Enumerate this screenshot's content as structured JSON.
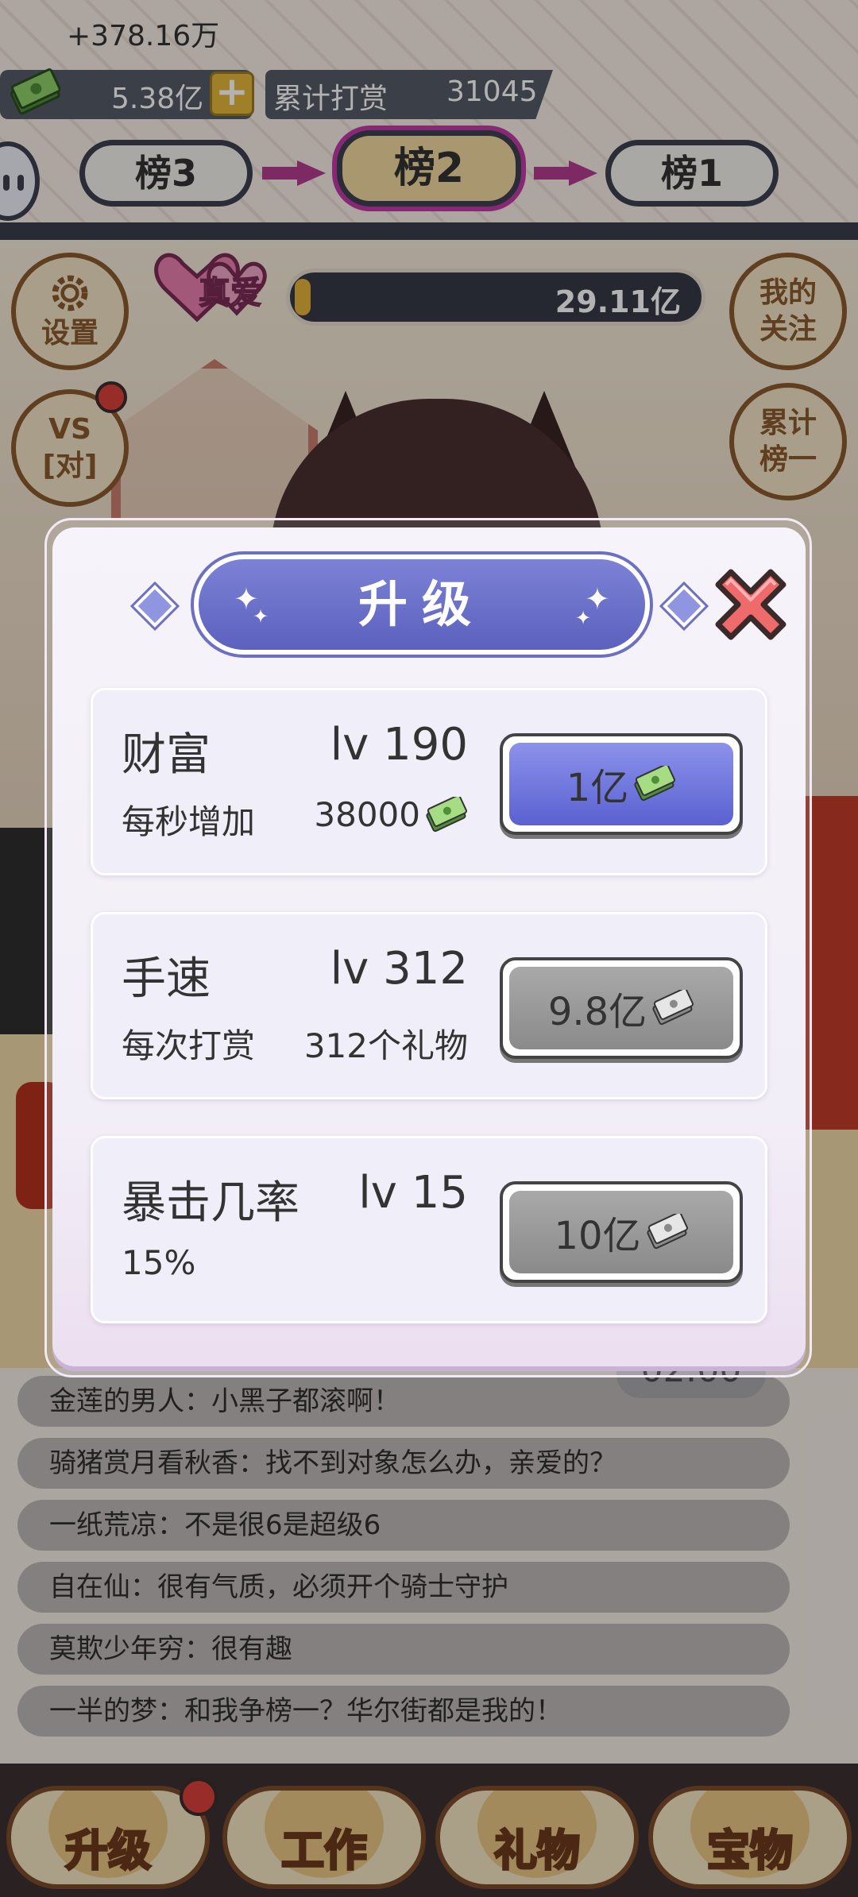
{
  "header": {
    "gain": "+378.16万",
    "money": "5.38亿",
    "plus": "+",
    "reward_label": "累计打赏",
    "reward_value": "31045"
  },
  "ranks": [
    "榜3",
    "榜2",
    "榜1"
  ],
  "side_buttons": {
    "settings": "设置",
    "vs": "VS\n[对]",
    "follow": "我的\n关注",
    "cumulative": "累计\n榜一"
  },
  "love": {
    "label": "真爱",
    "value": "29.11亿",
    "fill_fraction": 0.02
  },
  "timer": "02:00",
  "chat": [
    "金莲的男人：小黑子都滚啊！",
    "骑猪赏月看秋香：找不到对象怎么办，亲爱的？",
    "一纸荒凉：不是很6是超级6",
    "自在仙：很有气质，必须开个骑士守护",
    "莫欺少年穷：很有趣",
    "一半的梦：和我争榜一？华尔街都是我的！"
  ],
  "tabs": [
    "升级",
    "工作",
    "礼物",
    "宝物"
  ],
  "dialog": {
    "title": "升级",
    "items": [
      {
        "name": "财富",
        "level": "lv 190",
        "desc": "每秒增加",
        "desc_value": "38000",
        "cost": "1亿",
        "state": "active",
        "cost_icon": "money-icon",
        "desc_icon": "money-icon"
      },
      {
        "name": "手速",
        "level": "lv 312",
        "desc": "每次打赏",
        "desc_value": "312个礼物",
        "cost": "9.8亿",
        "state": "disabled",
        "cost_icon": "money-icon"
      },
      {
        "name": "暴击几率",
        "level": "lv 15",
        "desc": "15%",
        "desc_value": "",
        "cost": "10亿",
        "state": "disabled",
        "cost_icon": "money-icon"
      }
    ]
  },
  "colors": {
    "accent_purple": "#5b61bd",
    "rank_arrow": "#b43d90",
    "close_red": "#e8585a",
    "dot_red": "#d9403a"
  }
}
